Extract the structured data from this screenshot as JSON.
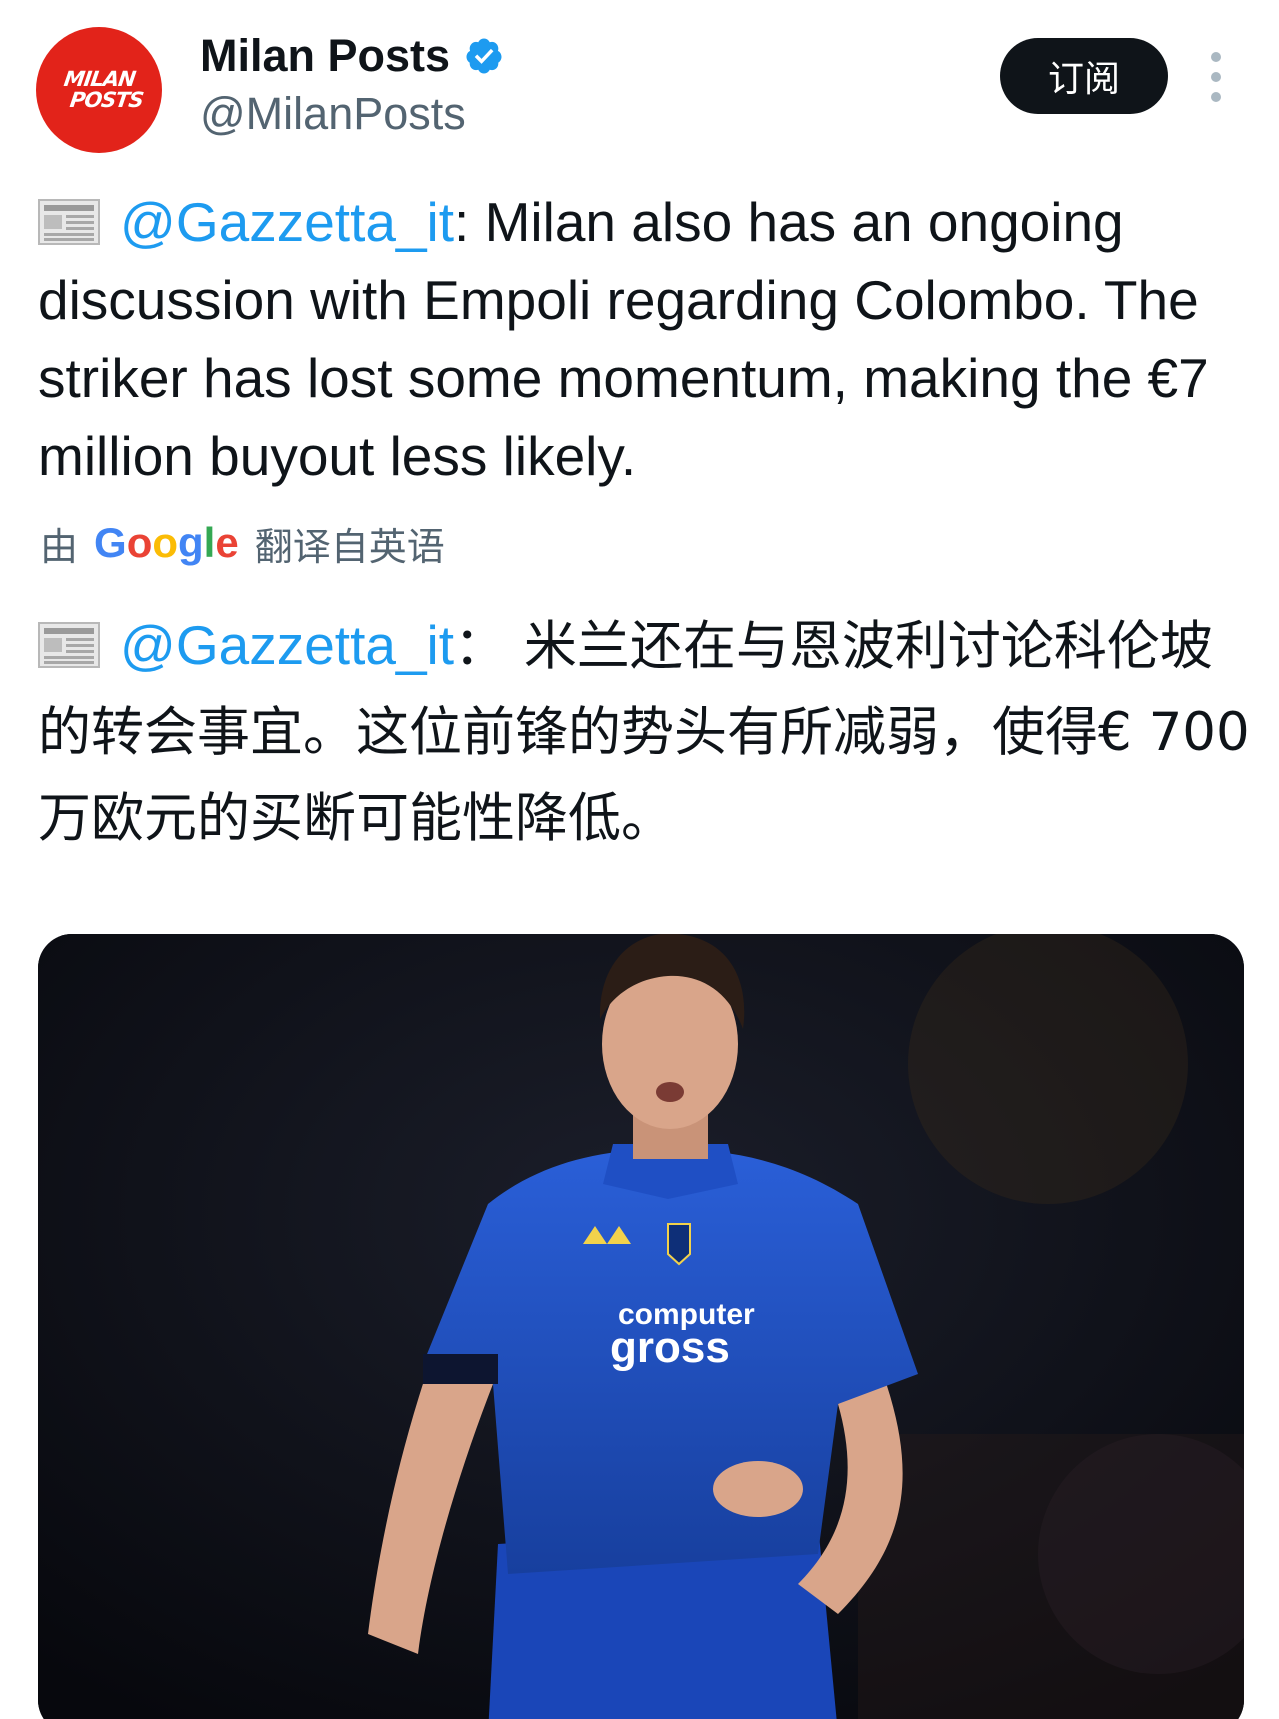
{
  "header": {
    "avatar_text_line1": "MILAN",
    "avatar_text_line2": "POSTS",
    "display_name": "Milan Posts",
    "handle": "@MilanPosts",
    "subscribe_label": "订阅",
    "verified_icon": "verified-badge-icon",
    "more_icon": "more-vertical-icon"
  },
  "tweet": {
    "news_icon": "newspaper-icon",
    "mention": "@Gazzetta_it",
    "text": ": Milan also has an ongoing discussion with Empoli regarding Colombo. The striker has lost some momentum, making the €7 million buyout less likely."
  },
  "translation": {
    "prefix": "由",
    "provider": "Google",
    "suffix": "翻译自英语"
  },
  "translated_tweet": {
    "mention": "@Gazzetta_it",
    "text": "： 米兰还在与恩波利讨论科伦坡的转会事宜。这位前锋的势头有所减弱，使得€ 700 万欧元的买断可能性降低。"
  },
  "media": {
    "jersey_sponsor_line1": "computer",
    "jersey_sponsor_line2": "gross",
    "colors": {
      "background": "#0b0d14",
      "jersey": "#1f4fc4",
      "skin": "#d9a58a"
    }
  },
  "colors": {
    "link": "#1d9bf0",
    "secondary_text": "#536471",
    "avatar_red": "#e2231a",
    "button_black": "#0f1419"
  }
}
